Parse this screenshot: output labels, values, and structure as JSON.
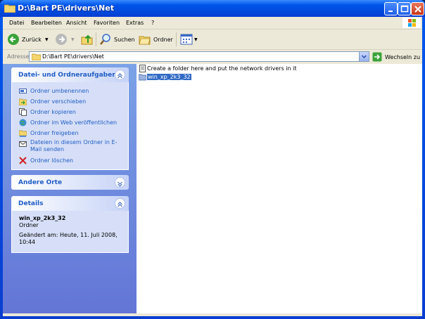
{
  "window": {
    "title": "D:\\Bart PE\\drivers\\Net"
  },
  "menu": {
    "items": [
      "Datei",
      "Bearbeiten",
      "Ansicht",
      "Favoriten",
      "Extras",
      "?"
    ]
  },
  "toolbar": {
    "back_label": "Zurück",
    "search_label": "Suchen",
    "folders_label": "Ordner"
  },
  "address": {
    "label": "Adresse",
    "value": "D:\\Bart PE\\drivers\\Net",
    "go_label": "Wechseln zu"
  },
  "tasks_panel": {
    "title": "Datei- und Ordneraufgaben",
    "items": [
      "Ordner umbenennen",
      "Ordner verschieben",
      "Ordner kopieren",
      "Ordner im Web veröffentlichen",
      "Ordner freigeben",
      "Dateien in diesem Ordner in E-Mail senden",
      "Ordner löschen"
    ]
  },
  "other_places": {
    "title": "Andere Orte"
  },
  "details": {
    "title": "Details",
    "name": "win_xp_2k3_32",
    "type": "Ordner",
    "modified": "Geändert am: Heute, 11. Juli 2008, 10:44"
  },
  "files": [
    {
      "name": "Create a folder here and put the network drivers in it",
      "icon": "text-file-icon",
      "selected": false
    },
    {
      "name": "win_xp_2k3_32",
      "icon": "folder-icon",
      "selected": true
    }
  ],
  "colors": {
    "title_blue": "#0055ea",
    "task_link": "#215dc6",
    "selection": "#316ac5"
  }
}
